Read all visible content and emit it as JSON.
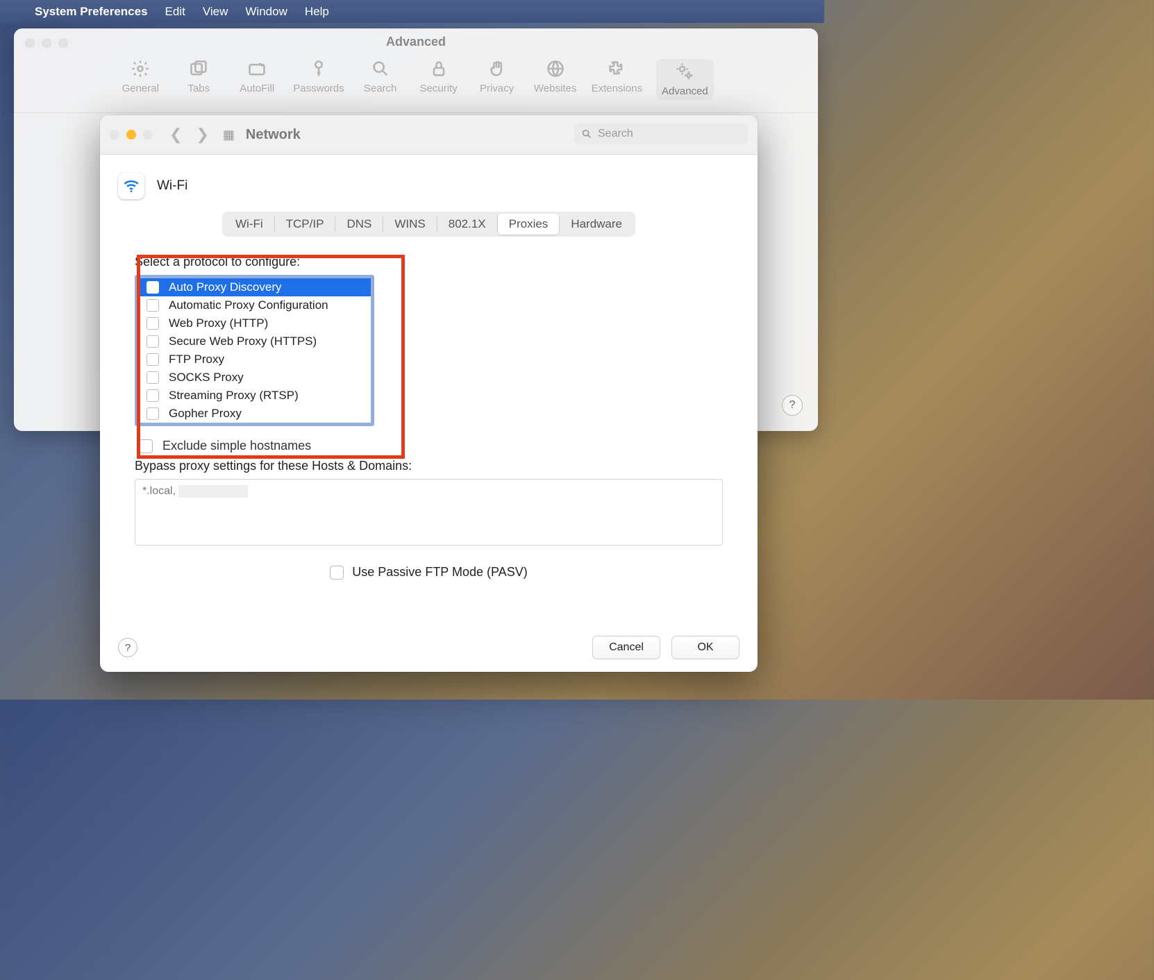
{
  "menubar": {
    "app": "System Preferences",
    "items": [
      "Edit",
      "View",
      "Window",
      "Help"
    ]
  },
  "bg_window": {
    "title": "Advanced",
    "toolbar": [
      {
        "id": "general",
        "label": "General"
      },
      {
        "id": "tabs",
        "label": "Tabs"
      },
      {
        "id": "autofill",
        "label": "AutoFill"
      },
      {
        "id": "passwords",
        "label": "Passwords"
      },
      {
        "id": "search",
        "label": "Search"
      },
      {
        "id": "security",
        "label": "Security"
      },
      {
        "id": "privacy",
        "label": "Privacy"
      },
      {
        "id": "websites",
        "label": "Websites"
      },
      {
        "id": "extensions",
        "label": "Extensions"
      },
      {
        "id": "advanced",
        "label": "Advanced"
      }
    ],
    "active": "advanced"
  },
  "fg_window": {
    "title": "Network",
    "search_placeholder": "Search",
    "interface": {
      "name": "Wi-Fi"
    },
    "tabs": [
      "Wi-Fi",
      "TCP/IP",
      "DNS",
      "WINS",
      "802.1X",
      "Proxies",
      "Hardware"
    ],
    "active_tab": "Proxies",
    "protocol_section_label": "Select a protocol to configure:",
    "protocols": [
      {
        "label": "Auto Proxy Discovery",
        "checked": false,
        "selected": true
      },
      {
        "label": "Automatic Proxy Configuration",
        "checked": false,
        "selected": false
      },
      {
        "label": "Web Proxy (HTTP)",
        "checked": false,
        "selected": false
      },
      {
        "label": "Secure Web Proxy (HTTPS)",
        "checked": false,
        "selected": false
      },
      {
        "label": "FTP Proxy",
        "checked": false,
        "selected": false
      },
      {
        "label": "SOCKS Proxy",
        "checked": false,
        "selected": false
      },
      {
        "label": "Streaming Proxy (RTSP)",
        "checked": false,
        "selected": false
      },
      {
        "label": "Gopher Proxy",
        "checked": false,
        "selected": false
      }
    ],
    "exclude_simple_label": "Exclude simple hostnames",
    "bypass_label": "Bypass proxy settings for these Hosts & Domains:",
    "bypass_value": "*.local, ",
    "passive_ftp_label": "Use Passive FTP Mode (PASV)",
    "cancel": "Cancel",
    "ok": "OK"
  }
}
